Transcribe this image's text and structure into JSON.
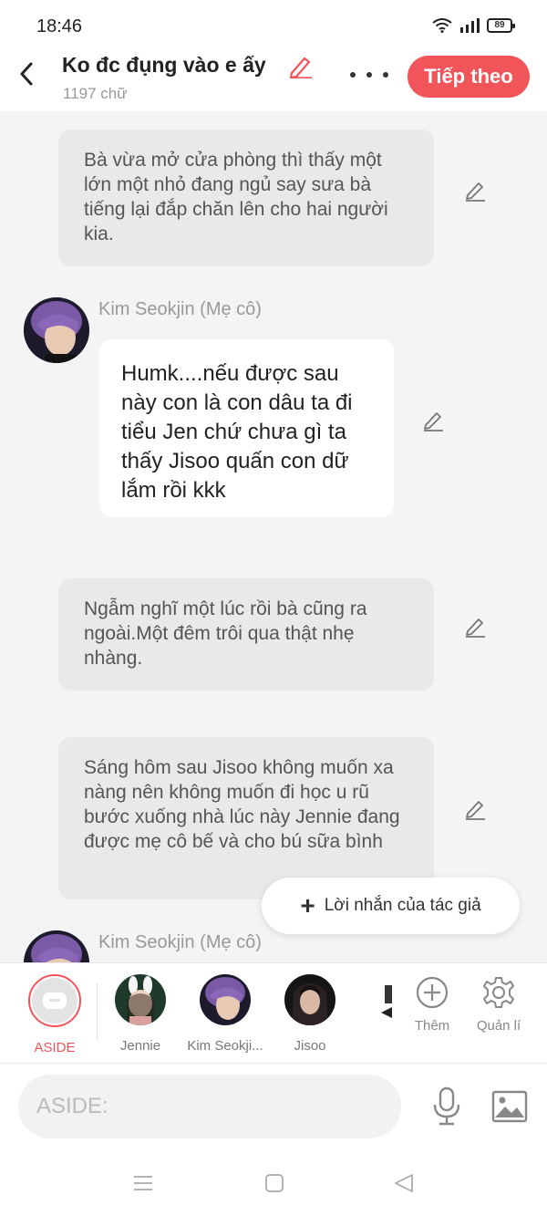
{
  "status": {
    "time": "18:46",
    "battery": "89"
  },
  "header": {
    "title": "Ko đc đụng vào e ấy",
    "word_count": "1197 chữ",
    "next_label": "Tiếp theo"
  },
  "messages": [
    {
      "type": "narration",
      "text": "Bà vừa mở cửa phòng thì thấy một lớn một nhỏ đang ngủ say sưa bà tiếng lại đắp chăn lên cho hai người kia."
    },
    {
      "type": "dialog",
      "speaker": "Kim Seokjin (Mẹ cô)",
      "text": "Humk....nếu được sau này con là con dâu ta đi tiểu Jen chứ chưa gì ta thấy Jisoo quấn con dữ lắm rồi  kkk"
    },
    {
      "type": "narration",
      "text": "Ngẫm nghĩ một lúc rồi bà cũng ra ngoài.Một đêm trôi qua thật nhẹ nhàng."
    },
    {
      "type": "narration",
      "text": "Sáng hôm sau Jisoo không muốn xa nàng nên không muốn đi học u rũ bước xuống nhà lúc này Jennie đang được  mẹ cô bế và cho bú sữa bình"
    },
    {
      "type": "dialog",
      "speaker": "Kim Seokjin (Mẹ cô)",
      "text": ""
    }
  ],
  "author_note_label": "Lời nhắn của tác giả",
  "characters": [
    {
      "label": "ASIDE",
      "selected": true
    },
    {
      "label": "Jennie"
    },
    {
      "label": "Kim Seokji..."
    },
    {
      "label": "Jisoo"
    }
  ],
  "tools": {
    "add_label": "Thêm",
    "manage_label": "Quản lí"
  },
  "input": {
    "placeholder": "ASIDE:"
  },
  "colors": {
    "accent": "#f25559",
    "narration_bg": "#e9e9e9",
    "page_bg": "#f4f4f4"
  },
  "icons": [
    "back-arrow-icon",
    "pencil-icon",
    "more-dots-icon",
    "plus-icon",
    "add-circle-icon",
    "gear-icon",
    "microphone-icon",
    "image-icon",
    "menu-icon",
    "home-square-icon",
    "back-triangle-icon"
  ]
}
